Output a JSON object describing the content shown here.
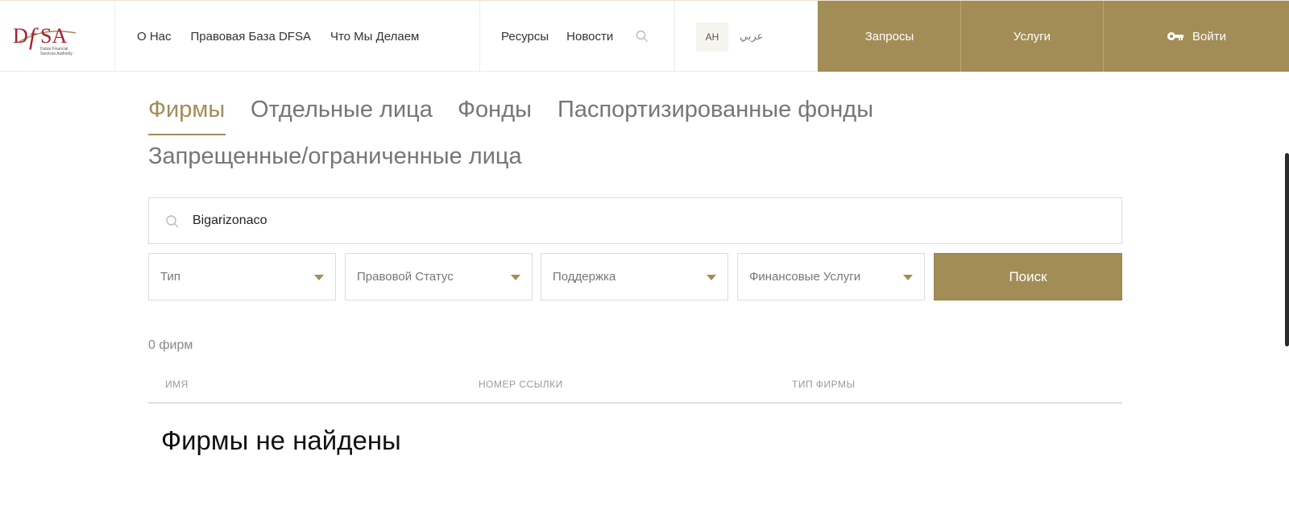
{
  "header": {
    "logo_text": "DFSA",
    "logo_subtitle": "Dubai Financial Services Authority",
    "nav_primary": [
      "О Нас",
      "Правовая База DFSA",
      "Что Мы Делаем"
    ],
    "nav_secondary": [
      "Ресурсы",
      "Новости"
    ],
    "lang_active": "AH",
    "lang_arabic": "عربي",
    "requests_label": "Запросы",
    "services_label": "Услуги",
    "login_label": "Войти"
  },
  "tabs": [
    "Фирмы",
    "Отдельные лица",
    "Фонды",
    "Паспортизированные фонды",
    "Запрещенные/ограниченные лица"
  ],
  "search": {
    "value": "Bigarizonaco",
    "placeholder": ""
  },
  "filters": [
    "Тип",
    "Правовой Статус",
    "Поддержка",
    "Финансовые Услуги"
  ],
  "search_button": "Поиск",
  "results": {
    "count_text": "0 фирм",
    "columns": [
      "ИМЯ",
      "НОМЕР ССЫЛКИ",
      "ТИП ФИРМЫ"
    ],
    "empty_message": "Фирмы не найдены"
  },
  "colors": {
    "accent": "#a28d57",
    "logo_red": "#a5202e"
  }
}
